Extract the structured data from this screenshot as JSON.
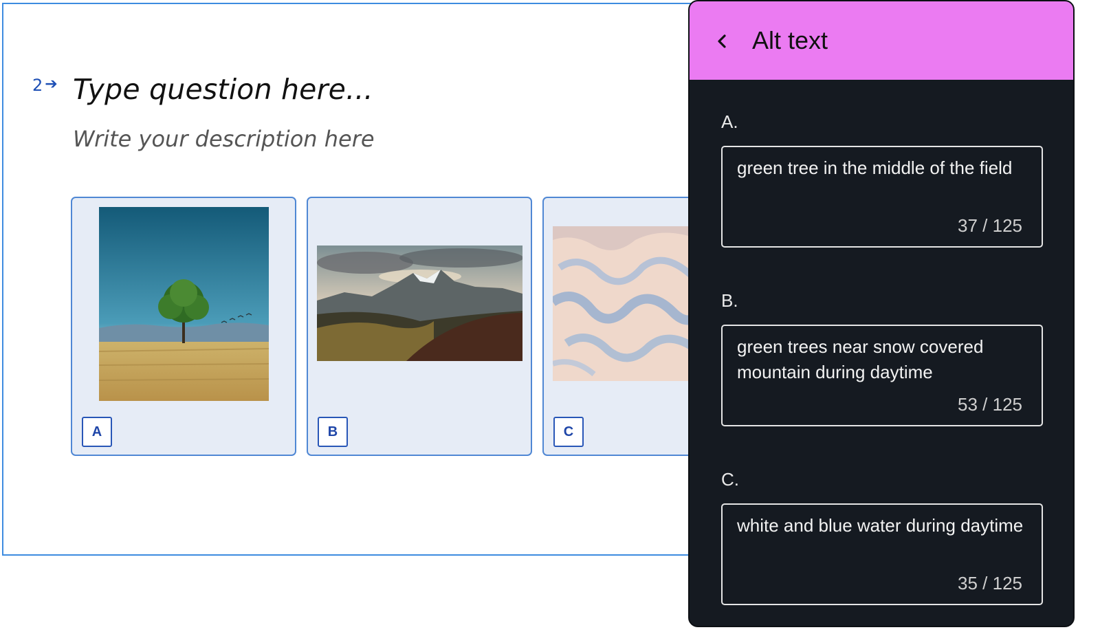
{
  "question": {
    "number": "2",
    "arrow": "➔",
    "title": "Type question here...",
    "description": "Write your description here"
  },
  "choices": [
    {
      "letter": "A",
      "image": "green-tree-in-field"
    },
    {
      "letter": "B",
      "image": "mountain-landscape"
    },
    {
      "letter": "C",
      "image": "sand-dunes"
    }
  ],
  "panel": {
    "title": "Alt text",
    "header_color": "#eb7bf2",
    "back_icon": "chevron-left-icon",
    "fields": [
      {
        "label": "A.",
        "value": "green tree in the middle of the field",
        "count": "37 / 125"
      },
      {
        "label": "B.",
        "value": "green trees near snow covered mountain during daytime",
        "count": "53 / 125"
      },
      {
        "label": "C.",
        "value": "white and blue water during daytime",
        "count": "35 / 125"
      }
    ]
  }
}
